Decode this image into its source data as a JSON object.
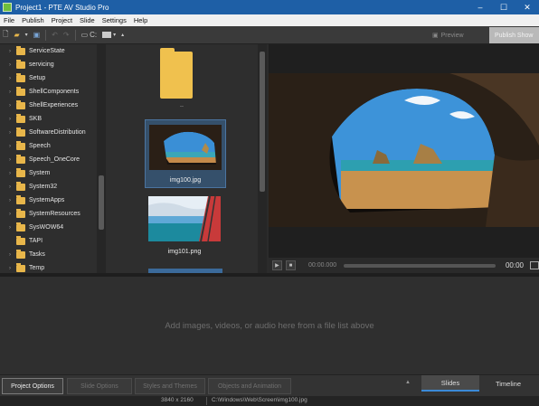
{
  "window": {
    "title": "Project1 - PTE AV Studio Pro",
    "controls": [
      "–",
      "☐",
      "✕"
    ]
  },
  "menu": [
    "File",
    "Publish",
    "Project",
    "Slide",
    "Settings",
    "Help"
  ],
  "toolbar": {
    "drive_label": "C:",
    "preview_label": "Preview",
    "publish_label": "Publish Show"
  },
  "folder_tree": [
    "ServiceState",
    "servicing",
    "Setup",
    "ShellComponents",
    "ShellExperiences",
    "SKB",
    "SoftwareDistribution",
    "Speech",
    "Speech_OneCore",
    "System",
    "System32",
    "SystemApps",
    "SystemResources",
    "SysWOW64",
    "TAPI",
    "Tasks",
    "Temp"
  ],
  "file_list": {
    "up_folder_label": "..",
    "items": [
      {
        "name": "img100.jpg",
        "selected": true
      },
      {
        "name": "img101.png",
        "selected": false
      }
    ]
  },
  "transport": {
    "current_time": "00:00.000",
    "end_time": "00:00"
  },
  "timeline": {
    "hint": "Add images, videos, or audio here from a file list above"
  },
  "bottom": {
    "project_options": "Project Options",
    "slide_options": "Slide Options",
    "styles_themes": "Styles and Themes",
    "objects_animation": "Objects and Animation",
    "tab_slides": "Slides",
    "tab_timeline": "Timeline"
  },
  "status": {
    "resolution": "3840 x 2160",
    "path": "C:\\Windows\\Web\\Screen\\img100.jpg"
  },
  "colors": {
    "titlebar": "#1e5fa6",
    "accent": "#3b8ad8",
    "folder": "#f0c14e"
  }
}
